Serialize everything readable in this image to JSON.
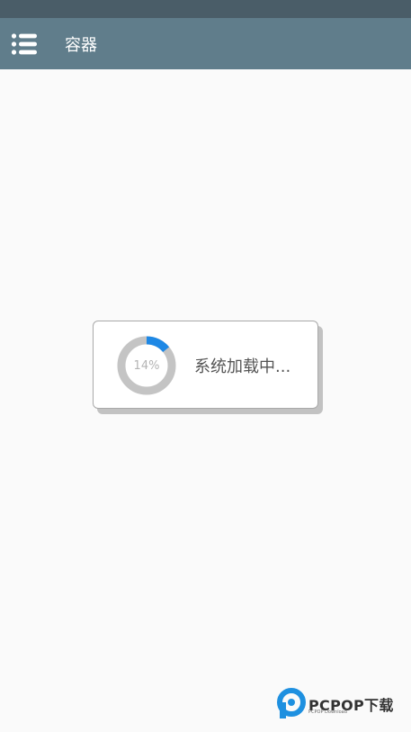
{
  "app_bar": {
    "title": "容器",
    "menu_icon": "list-menu-icon",
    "background_color": "#607d8b"
  },
  "status_bar": {
    "background_color": "#4a5d68"
  },
  "loading_dialog": {
    "progress_percent": 14,
    "progress_label": "14%",
    "message": "系统加载中...",
    "accent_color": "#1e88e5",
    "track_color": "#c4c4c4"
  },
  "watermark": {
    "brand": "PCPOP下载",
    "sub": "PCPOP Download",
    "logo_icon": "pcpop-logo-icon",
    "logo_color": "#1e90e0"
  }
}
